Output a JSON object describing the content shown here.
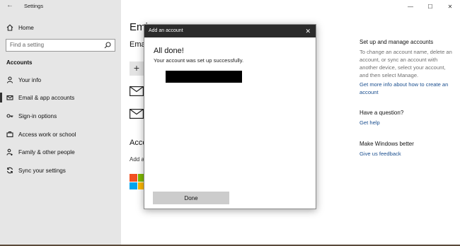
{
  "window": {
    "title": "Settings",
    "back_glyph": "←",
    "minimize": "—",
    "maximize": "☐",
    "close": "✕"
  },
  "sidebar": {
    "home_label": "Home",
    "search_placeholder": "Find a setting",
    "section": "Accounts",
    "items": [
      {
        "label": "Your info",
        "icon": "person-icon"
      },
      {
        "label": "Email & app accounts",
        "icon": "mail-icon"
      },
      {
        "label": "Sign-in options",
        "icon": "key-icon"
      },
      {
        "label": "Access work or school",
        "icon": "briefcase-icon"
      },
      {
        "label": "Family & other people",
        "icon": "people-icon"
      },
      {
        "label": "Sync your settings",
        "icon": "sync-icon"
      }
    ]
  },
  "main": {
    "heading_partial": "Emi",
    "subhead_partial": "Ema",
    "accounts_partial": "Acco",
    "add_partial": "Add a"
  },
  "help_panel": {
    "manage_heading": "Set up and manage accounts",
    "manage_text": "To change an account name, delete an account, or sync an account with another device, select your account, and then select Manage.",
    "manage_link": "Get more info about how to create an account",
    "question_heading": "Have a question?",
    "question_link": "Get help",
    "better_heading": "Make Windows better",
    "better_link": "Give us feedback"
  },
  "dialog": {
    "title": "Add an account",
    "close_glyph": "✕",
    "heading": "All done!",
    "message": "Your account was set up successfully.",
    "done_label": "Done"
  },
  "colors": {
    "sidebar_bg": "#e6e6e6",
    "dialog_title_bg": "#2b2b2b",
    "button_bg": "#cccccc",
    "link": "#1b4f8f"
  }
}
